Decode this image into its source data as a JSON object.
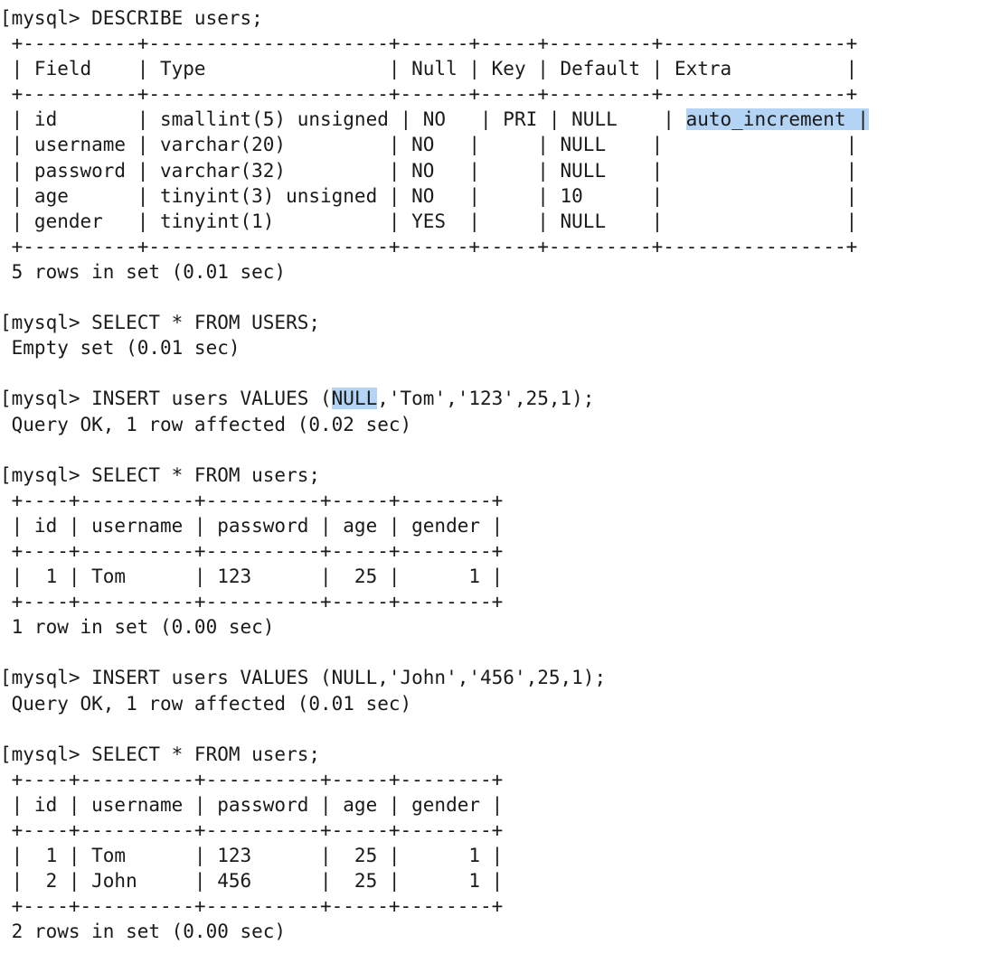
{
  "terminal": {
    "app": "mysql-client-terminal",
    "background_color": "#ffffff",
    "text_color": "#1a1a1a",
    "highlight_color": "#b3d4f5",
    "font_size_px": 21,
    "line_height_px": 28,
    "prompt": "mysql>",
    "lines": [
      {
        "id": "l01",
        "type": "command",
        "text": "[mysql> DESCRIBE users;"
      },
      {
        "id": "l02",
        "type": "rule",
        "text": " +----------+---------------------+------+-----+---------+----------------+"
      },
      {
        "id": "l03",
        "type": "header",
        "text": " | Field    | Type                | Null | Key | Default | Extra          |"
      },
      {
        "id": "l04",
        "type": "rule",
        "text": " +----------+---------------------+------+-----+---------+----------------+"
      },
      {
        "id": "l05",
        "type": "row",
        "text": " | id       | smallint(5) unsigned | NO   | PRI | NULL    | ",
        "highlight": "auto_increment |"
      },
      {
        "id": "l06",
        "type": "row",
        "text": " | username | varchar(20)         | NO   |     | NULL    |                |"
      },
      {
        "id": "l07",
        "type": "row",
        "text": " | password | varchar(32)         | NO   |     | NULL    |                |"
      },
      {
        "id": "l08",
        "type": "row",
        "text": " | age      | tinyint(3) unsigned | NO   |     | 10      |                |"
      },
      {
        "id": "l09",
        "type": "row",
        "text": " | gender   | tinyint(1)          | YES  |     | NULL    |                |"
      },
      {
        "id": "l10",
        "type": "rule",
        "text": " +----------+---------------------+------+-----+---------+----------------+"
      },
      {
        "id": "l11",
        "type": "status",
        "text": " 5 rows in set (0.01 sec)"
      },
      {
        "id": "l12",
        "type": "blank",
        "text": ""
      },
      {
        "id": "l13",
        "type": "command",
        "text": "[mysql> SELECT * FROM USERS;"
      },
      {
        "id": "l14",
        "type": "status",
        "text": " Empty set (0.01 sec)"
      },
      {
        "id": "l15",
        "type": "blank",
        "text": ""
      },
      {
        "id": "l16",
        "type": "command",
        "text": "[mysql> INSERT users VALUES (",
        "highlight": "NULL",
        "text2": ",'Tom','123',25,1);"
      },
      {
        "id": "l17",
        "type": "status",
        "text": " Query OK, 1 row affected (0.02 sec)"
      },
      {
        "id": "l18",
        "type": "blank",
        "text": ""
      },
      {
        "id": "l19",
        "type": "command",
        "text": "[mysql> SELECT * FROM users;"
      },
      {
        "id": "l20",
        "type": "rule",
        "text": " +----+----------+----------+-----+--------+"
      },
      {
        "id": "l21",
        "type": "header",
        "text": " | id | username | password | age | gender |"
      },
      {
        "id": "l22",
        "type": "rule",
        "text": " +----+----------+----------+-----+--------+"
      },
      {
        "id": "l23",
        "type": "row",
        "text": " |  1 | Tom      | 123      |  25 |      1 |"
      },
      {
        "id": "l24",
        "type": "rule",
        "text": " +----+----------+----------+-----+--------+"
      },
      {
        "id": "l25",
        "type": "status",
        "text": " 1 row in set (0.00 sec)"
      },
      {
        "id": "l26",
        "type": "blank",
        "text": ""
      },
      {
        "id": "l27",
        "type": "command",
        "text": "[mysql> INSERT users VALUES (NULL,'John','456',25,1);"
      },
      {
        "id": "l28",
        "type": "status",
        "text": " Query OK, 1 row affected (0.01 sec)"
      },
      {
        "id": "l29",
        "type": "blank",
        "text": ""
      },
      {
        "id": "l30",
        "type": "command",
        "text": "[mysql> SELECT * FROM users;"
      },
      {
        "id": "l31",
        "type": "rule",
        "text": " +----+----------+----------+-----+--------+"
      },
      {
        "id": "l32",
        "type": "header",
        "text": " | id | username | password | age | gender |"
      },
      {
        "id": "l33",
        "type": "rule",
        "text": " +----+----------+----------+-----+--------+"
      },
      {
        "id": "l34",
        "type": "row",
        "text": " |  1 | Tom      | 123      |  25 |      1 |"
      },
      {
        "id": "l35",
        "type": "row",
        "text": " |  2 | John     | 456      |  25 |      1 |"
      },
      {
        "id": "l36",
        "type": "rule",
        "text": " +----+----------+----------+-----+--------+"
      },
      {
        "id": "l37",
        "type": "status",
        "text": " 2 rows in set (0.00 sec)"
      }
    ]
  },
  "describe_result": {
    "statement": "DESCRIBE users;",
    "columns": [
      "Field",
      "Type",
      "Null",
      "Key",
      "Default",
      "Extra"
    ],
    "rows": [
      [
        "id",
        "smallint(5) unsigned",
        "NO",
        "PRI",
        "NULL",
        "auto_increment"
      ],
      [
        "username",
        "varchar(20)",
        "NO",
        "",
        "NULL",
        ""
      ],
      [
        "password",
        "varchar(32)",
        "NO",
        "",
        "NULL",
        ""
      ],
      [
        "age",
        "tinyint(3) unsigned",
        "NO",
        "",
        "10",
        ""
      ],
      [
        "gender",
        "tinyint(1)",
        "YES",
        "",
        "NULL",
        ""
      ]
    ],
    "footer": "5 rows in set (0.01 sec)",
    "selected_cell": "auto_increment"
  },
  "select_empty": {
    "statement": "SELECT * FROM USERS;",
    "footer": "Empty set (0.01 sec)"
  },
  "insert_tom": {
    "statement": "INSERT users VALUES (NULL,'Tom','123',25,1);",
    "selected_token": "NULL",
    "footer": "Query OK, 1 row affected (0.02 sec)"
  },
  "select_one": {
    "statement": "SELECT * FROM users;",
    "columns": [
      "id",
      "username",
      "password",
      "age",
      "gender"
    ],
    "rows": [
      [
        "1",
        "Tom",
        "123",
        "25",
        "1"
      ]
    ],
    "footer": "1 row in set (0.00 sec)"
  },
  "insert_john": {
    "statement": "INSERT users VALUES (NULL,'John','456',25,1);",
    "footer": "Query OK, 1 row affected (0.01 sec)"
  },
  "select_two": {
    "statement": "SELECT * FROM users;",
    "columns": [
      "id",
      "username",
      "password",
      "age",
      "gender"
    ],
    "rows": [
      [
        "1",
        "Tom",
        "123",
        "25",
        "1"
      ],
      [
        "2",
        "John",
        "456",
        "25",
        "1"
      ]
    ],
    "footer": "2 rows in set (0.00 sec)"
  }
}
